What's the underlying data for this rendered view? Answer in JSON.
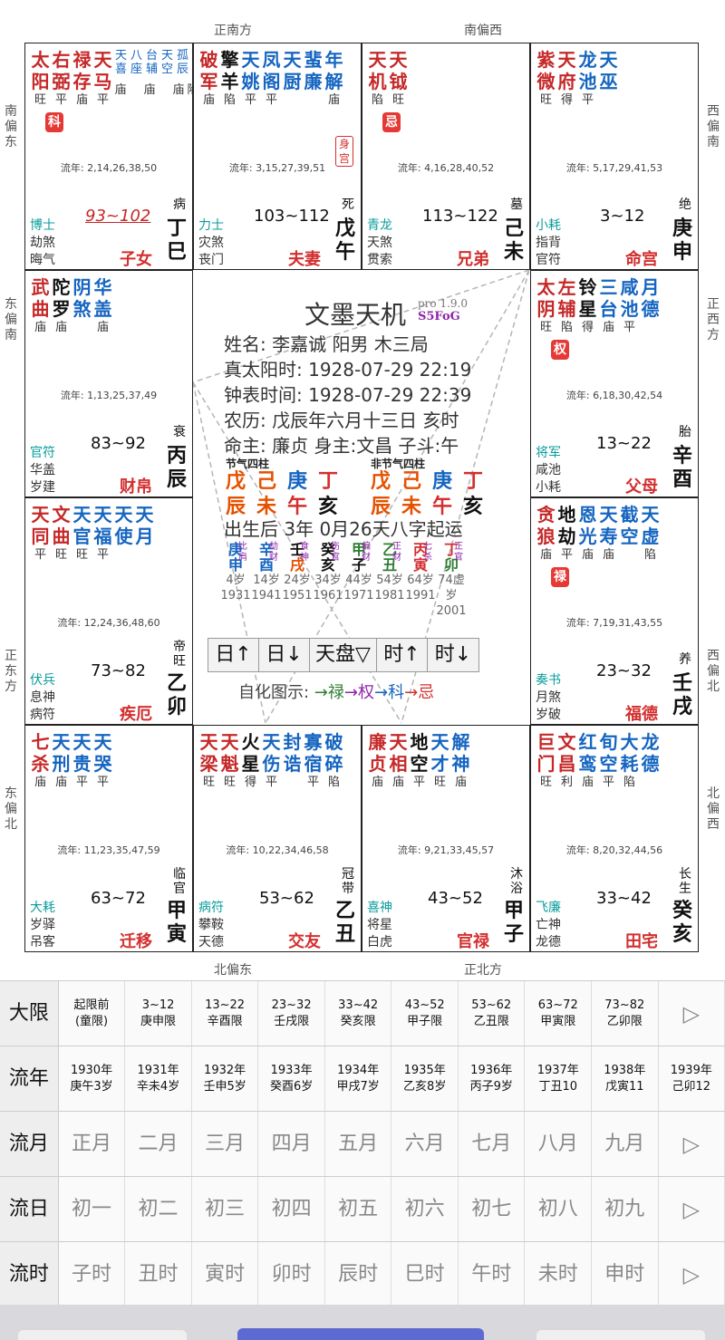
{
  "directions": {
    "top_a": "正南方",
    "top_b": "南偏西",
    "bottom_a": "北偏东",
    "bottom_b": "正北方",
    "left_1": "南偏东",
    "left_2": "东偏南",
    "left_3": "正东方",
    "left_4": "东偏北",
    "right_1": "西偏南",
    "right_2": "正西方",
    "right_3": "西偏北",
    "right_4": "北偏西"
  },
  "palaces": [
    {
      "id": "si",
      "major": [
        {
          "n": "太阳",
          "b": "旺",
          "c": "#c62828"
        },
        {
          "n": "右弼",
          "b": "平",
          "c": "#c62828"
        },
        {
          "n": "禄存",
          "b": "庙",
          "c": "#c62828"
        },
        {
          "n": "天马",
          "b": "平",
          "c": "#c62828"
        }
      ],
      "minor": [
        "天喜",
        "八座",
        "台辅",
        "天空",
        "孤辰",
        "劫煞"
      ],
      "minor_b": [
        "庙",
        "",
        "庙",
        "",
        "庙",
        "陷"
      ],
      "hua": "科",
      "flow": "流年: 2,14,26,38,50",
      "gods": [
        "博士",
        "劫煞",
        "晦气"
      ],
      "range": "93~102",
      "state": "病",
      "name": "子女",
      "gz": "丁巳"
    },
    {
      "id": "wu",
      "major": [
        {
          "n": "破军",
          "b": "庙",
          "c": "#c62828"
        },
        {
          "n": "擎羊",
          "b": "陷",
          "c": "#111"
        },
        {
          "n": "天姚",
          "b": "平",
          "c": "#1565c0"
        },
        {
          "n": "凤阁",
          "b": "平",
          "c": "#1565c0"
        },
        {
          "n": "天厨",
          "b": "",
          "c": "#1565c0"
        },
        {
          "n": "蜚廉",
          "b": "",
          "c": "#1565c0"
        },
        {
          "n": "年解",
          "b": "庙",
          "c": "#1565c0"
        }
      ],
      "shen": "身宫",
      "flow": "流年: 3,15,27,39,51",
      "gods": [
        "力士",
        "灾煞",
        "丧门"
      ],
      "range": "103~112",
      "state": "死",
      "name": "夫妻",
      "gz": "戊午"
    },
    {
      "id": "wei",
      "major": [
        {
          "n": "天机",
          "b": "陷",
          "c": "#c62828"
        },
        {
          "n": "天钺",
          "b": "旺",
          "c": "#c62828"
        }
      ],
      "hua": "忌",
      "flow": "流年: 4,16,28,40,52",
      "gods": [
        "青龙",
        "天煞",
        "贯索"
      ],
      "range": "113~122",
      "state": "墓",
      "name": "兄弟",
      "gz": "己未"
    },
    {
      "id": "shen",
      "major": [
        {
          "n": "紫微",
          "b": "旺",
          "c": "#c62828"
        },
        {
          "n": "天府",
          "b": "得",
          "c": "#c62828"
        },
        {
          "n": "龙池",
          "b": "平",
          "c": "#1565c0"
        },
        {
          "n": "天巫",
          "b": "",
          "c": "#1565c0"
        }
      ],
      "flow": "流年: 5,17,29,41,53",
      "gods": [
        "小耗",
        "指背",
        "官符"
      ],
      "range": "3~12",
      "state": "绝",
      "name": "命宫",
      "gz": "庚申"
    },
    {
      "id": "chen",
      "major": [
        {
          "n": "武曲",
          "b": "庙",
          "c": "#c62828"
        },
        {
          "n": "陀罗",
          "b": "庙",
          "c": "#111"
        },
        {
          "n": "阴煞",
          "b": "",
          "c": "#1565c0"
        },
        {
          "n": "华盖",
          "b": "庙",
          "c": "#1565c0"
        }
      ],
      "flow": "流年: 1,13,25,37,49",
      "gods": [
        "官符",
        "华盖",
        "岁建"
      ],
      "range": "83~92",
      "state": "衰",
      "name": "财帛",
      "gz": "丙辰"
    },
    {
      "id": "you",
      "major": [
        {
          "n": "太阴",
          "b": "旺",
          "c": "#c62828"
        },
        {
          "n": "左辅",
          "b": "陷",
          "c": "#c62828"
        },
        {
          "n": "铃星",
          "b": "得",
          "c": "#111"
        },
        {
          "n": "三台",
          "b": "庙",
          "c": "#1565c0"
        },
        {
          "n": "咸池",
          "b": "平",
          "c": "#1565c0"
        },
        {
          "n": "月德",
          "b": "",
          "c": "#1565c0"
        }
      ],
      "hua": "权",
      "flow": "流年: 6,18,30,42,54",
      "gods": [
        "将军",
        "咸池",
        "小耗"
      ],
      "range": "13~22",
      "state": "胎",
      "name": "父母",
      "gz": "辛酉"
    },
    {
      "id": "mao",
      "major": [
        {
          "n": "天同",
          "b": "平",
          "c": "#c62828"
        },
        {
          "n": "文曲",
          "b": "旺",
          "c": "#c62828"
        },
        {
          "n": "天官",
          "b": "旺",
          "c": "#1565c0"
        },
        {
          "n": "天福",
          "b": "平",
          "c": "#1565c0"
        },
        {
          "n": "天使",
          "b": "",
          "c": "#1565c0"
        },
        {
          "n": "天月",
          "b": "",
          "c": "#1565c0"
        }
      ],
      "flow": "流年: 12,24,36,48,60",
      "gods": [
        "伏兵",
        "息神",
        "病符"
      ],
      "range": "73~82",
      "state": "帝旺",
      "name": "疾厄",
      "gz": "乙卯"
    },
    {
      "id": "xu",
      "major": [
        {
          "n": "贪狼",
          "b": "庙",
          "c": "#c62828"
        },
        {
          "n": "地劫",
          "b": "平",
          "c": "#111"
        },
        {
          "n": "恩光",
          "b": "庙",
          "c": "#1565c0"
        },
        {
          "n": "天寿",
          "b": "庙",
          "c": "#1565c0"
        },
        {
          "n": "截空",
          "b": "",
          "c": "#1565c0"
        },
        {
          "n": "天虚",
          "b": "陷",
          "c": "#1565c0"
        }
      ],
      "hua": "禄",
      "flow": "流年: 7,19,31,43,55",
      "gods": [
        "奏书",
        "月煞",
        "岁破"
      ],
      "range": "23~32",
      "state": "养",
      "name": "福德",
      "gz": "壬戌"
    },
    {
      "id": "yin",
      "major": [
        {
          "n": "七杀",
          "b": "庙",
          "c": "#c62828"
        },
        {
          "n": "天刑",
          "b": "庙",
          "c": "#1565c0"
        },
        {
          "n": "天贵",
          "b": "平",
          "c": "#1565c0"
        },
        {
          "n": "天哭",
          "b": "平",
          "c": "#1565c0"
        }
      ],
      "flow": "流年: 11,23,35,47,59",
      "gods": [
        "大耗",
        "岁驿",
        "吊客"
      ],
      "range": "63~72",
      "state": "临官",
      "name": "迁移",
      "gz": "甲寅"
    },
    {
      "id": "chou",
      "major": [
        {
          "n": "天梁",
          "b": "旺",
          "c": "#c62828"
        },
        {
          "n": "天魁",
          "b": "旺",
          "c": "#c62828"
        },
        {
          "n": "火星",
          "b": "得",
          "c": "#111"
        },
        {
          "n": "天伤",
          "b": "平",
          "c": "#1565c0"
        },
        {
          "n": "封诰",
          "b": "",
          "c": "#1565c0"
        },
        {
          "n": "寡宿",
          "b": "平",
          "c": "#1565c0"
        },
        {
          "n": "破碎",
          "b": "陷",
          "c": "#1565c0"
        },
        {
          "n": "天德",
          "b": "庙",
          "c": "#1565c0"
        }
      ],
      "flow": "流年: 10,22,34,46,58",
      "gods": [
        "病符",
        "攀鞍",
        "天德"
      ],
      "range": "53~62",
      "state": "冠带",
      "name": "交友",
      "gz": "乙丑"
    },
    {
      "id": "zi",
      "major": [
        {
          "n": "廉贞",
          "b": "庙",
          "c": "#c62828"
        },
        {
          "n": "天相",
          "b": "庙",
          "c": "#c62828"
        },
        {
          "n": "地空",
          "b": "平",
          "c": "#111"
        },
        {
          "n": "天才",
          "b": "旺",
          "c": "#1565c0"
        },
        {
          "n": "解神",
          "b": "庙",
          "c": "#1565c0"
        }
      ],
      "flow": "流年: 9,21,33,45,57",
      "gods": [
        "喜神",
        "将星",
        "白虎"
      ],
      "range": "43~52",
      "state": "沐浴",
      "name": "官禄",
      "gz": "甲子"
    },
    {
      "id": "hai",
      "major": [
        {
          "n": "巨门",
          "b": "旺",
          "c": "#c62828"
        },
        {
          "n": "文昌",
          "b": "利",
          "c": "#c62828"
        },
        {
          "n": "红鸾",
          "b": "庙",
          "c": "#1565c0"
        },
        {
          "n": "旬空",
          "b": "平",
          "c": "#1565c0"
        },
        {
          "n": "大耗",
          "b": "陷",
          "c": "#1565c0"
        },
        {
          "n": "龙德",
          "b": "",
          "c": "#1565c0"
        }
      ],
      "flow": "流年: 8,20,32,44,56",
      "gods": [
        "飞廉",
        "亡神",
        "龙德"
      ],
      "range": "33~42",
      "state": "长生",
      "name": "田宅",
      "gz": "癸亥"
    }
  ],
  "center": {
    "title": "文墨天机",
    "version": "pro 1.9.0",
    "author": "S5FoG",
    "name_line": "姓名: 李嘉诚        阳男 木三局",
    "solar_line": "真太阳时: 1928-07-29 22:19",
    "clock_line": "钟表时间: 1928-07-29 22:39",
    "lunar_line": "农历: 戊辰年六月十三日 亥时",
    "master_line": "命主: 廉贞 身主:文昌 子斗:午",
    "label_jieqi": "节气四柱",
    "label_feijieqi": "非节气四柱",
    "pillars_a": [
      [
        "戊",
        "辰"
      ],
      [
        "己",
        "未"
      ],
      [
        "庚",
        "午"
      ],
      [
        "丁",
        "亥"
      ]
    ],
    "pillars_b": [
      [
        "戊",
        "辰"
      ],
      [
        "己",
        "未"
      ],
      [
        "庚",
        "午"
      ],
      [
        "丁",
        "亥"
      ]
    ],
    "qiyun_line": "出生后 3年 0月26天八字起运",
    "dayun": [
      {
        "s": "庚申",
        "g": "比肩",
        "age": "4岁",
        "yr": "1931"
      },
      {
        "s": "辛酉",
        "g": "劫财",
        "age": "14岁",
        "yr": "1941"
      },
      {
        "s": "壬戌",
        "g": "食神",
        "age": "24岁",
        "yr": "1951"
      },
      {
        "s": "癸亥",
        "g": "伤官",
        "age": "34岁",
        "yr": "1961"
      },
      {
        "s": "甲子",
        "g": "偏财",
        "age": "44岁",
        "yr": "1971"
      },
      {
        "s": "乙丑",
        "g": "正财",
        "age": "54岁",
        "yr": "1981"
      },
      {
        "s": "丙寅",
        "g": "七杀",
        "age": "64岁",
        "yr": "1991"
      },
      {
        "s": "丁卯",
        "g": "正官",
        "age": "74虚岁",
        "yr": "2001"
      }
    ],
    "buttons": [
      "日↑",
      "日↓",
      "天盘▽",
      "时↑",
      "时↓"
    ],
    "legend_prefix": "自化图示: ",
    "legend_items": [
      {
        "t": "→禄",
        "c": "#2e7d32"
      },
      {
        "t": "→权",
        "c": "#8e24aa"
      },
      {
        "t": "→科",
        "c": "#1565c0"
      },
      {
        "t": "→忌",
        "c": "#d32f2f"
      }
    ]
  },
  "bottom": {
    "rows": [
      {
        "head": "大限",
        "cells": [
          [
            "起限前",
            "(童限)"
          ],
          [
            "3~12",
            "庚申限"
          ],
          [
            "13~22",
            "辛酉限"
          ],
          [
            "23~32",
            "壬戌限"
          ],
          [
            "33~42",
            "癸亥限"
          ],
          [
            "43~52",
            "甲子限"
          ],
          [
            "53~62",
            "乙丑限"
          ],
          [
            "63~72",
            "甲寅限"
          ],
          [
            "73~82",
            "乙卯限"
          ]
        ],
        "more": "▷"
      },
      {
        "head": "流年",
        "cells": [
          [
            "1930年",
            "庚午3岁"
          ],
          [
            "1931年",
            "辛未4岁"
          ],
          [
            "1932年",
            "壬申5岁"
          ],
          [
            "1933年",
            "癸酉6岁"
          ],
          [
            "1934年",
            "甲戌7岁"
          ],
          [
            "1935年",
            "乙亥8岁"
          ],
          [
            "1936年",
            "丙子9岁"
          ],
          [
            "1937年",
            "丁丑10"
          ],
          [
            "1938年",
            "戊寅11"
          ],
          [
            "1939年",
            "己卯12"
          ]
        ]
      },
      {
        "head": "流月",
        "cells": [
          [
            "正月"
          ],
          [
            "二月"
          ],
          [
            "三月"
          ],
          [
            "四月"
          ],
          [
            "五月"
          ],
          [
            "六月"
          ],
          [
            "七月"
          ],
          [
            "八月"
          ],
          [
            "九月"
          ]
        ],
        "more": "▷"
      },
      {
        "head": "流日",
        "cells": [
          [
            "初一"
          ],
          [
            "初二"
          ],
          [
            "初三"
          ],
          [
            "初四"
          ],
          [
            "初五"
          ],
          [
            "初六"
          ],
          [
            "初七"
          ],
          [
            "初八"
          ],
          [
            "初九"
          ]
        ],
        "more": "▷"
      },
      {
        "head": "流时",
        "cells": [
          [
            "子时"
          ],
          [
            "丑时"
          ],
          [
            "寅时"
          ],
          [
            "卯时"
          ],
          [
            "辰时"
          ],
          [
            "巳时"
          ],
          [
            "午时"
          ],
          [
            "未时"
          ],
          [
            "申时"
          ]
        ],
        "more": "▷"
      }
    ]
  },
  "colors": {
    "red": "#d32f2f",
    "blue": "#1565c0",
    "teal": "#0a9c9c",
    "orange": "#e65100",
    "purple": "#8e24aa",
    "green": "#2e7d32"
  }
}
